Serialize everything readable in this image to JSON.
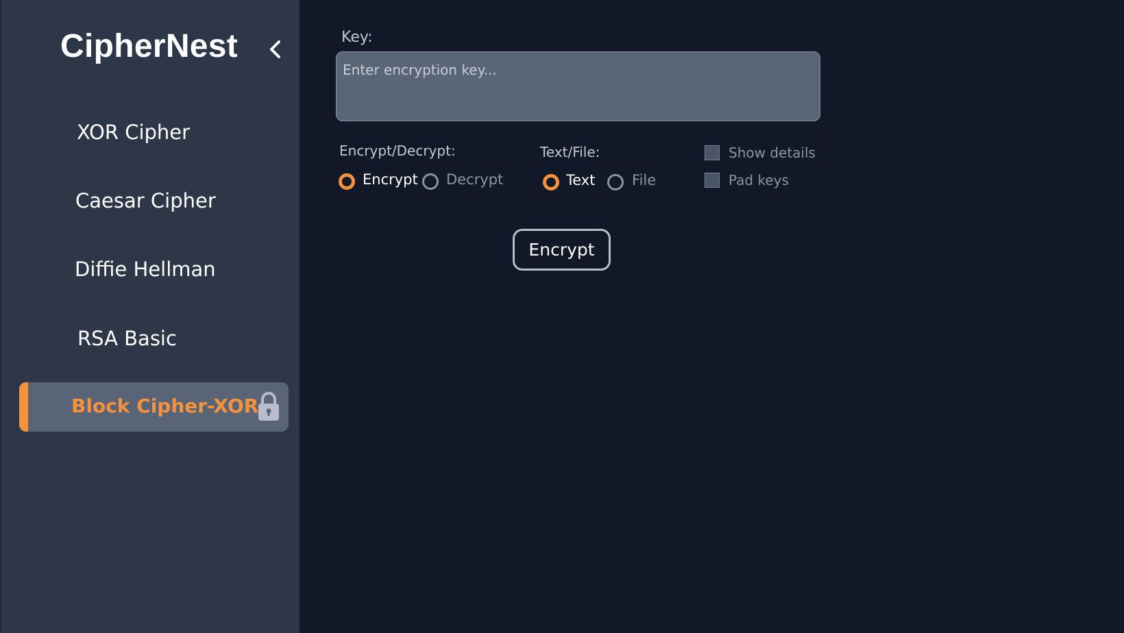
{
  "app": {
    "title": "CipherNest"
  },
  "sidebar": {
    "items": [
      {
        "label": "XOR Cipher"
      },
      {
        "label": "Caesar Cipher"
      },
      {
        "label": "Diffie Hellman"
      },
      {
        "label": "RSA Basic"
      },
      {
        "label": "Block Cipher-XOR",
        "active": true,
        "icon": "lock-icon"
      }
    ]
  },
  "form": {
    "key_label": "Key:",
    "key_placeholder": "Enter encryption key...",
    "key_value": "",
    "mode": {
      "label": "Encrypt/Decrypt:",
      "options": [
        "Encrypt",
        "Decrypt"
      ],
      "selected": "Encrypt"
    },
    "input_type": {
      "label": "Text/File:",
      "options": [
        "Text",
        "File"
      ],
      "selected": "Text"
    },
    "checkboxes": [
      {
        "label": "Show details",
        "checked": false
      },
      {
        "label": "Pad keys",
        "checked": false
      }
    ],
    "submit_label": "Encrypt"
  },
  "colors": {
    "accent": "#f6913e",
    "sidebar_bg": "#2d3748",
    "main_bg": "#111827",
    "active_item_bg": "#596577"
  }
}
